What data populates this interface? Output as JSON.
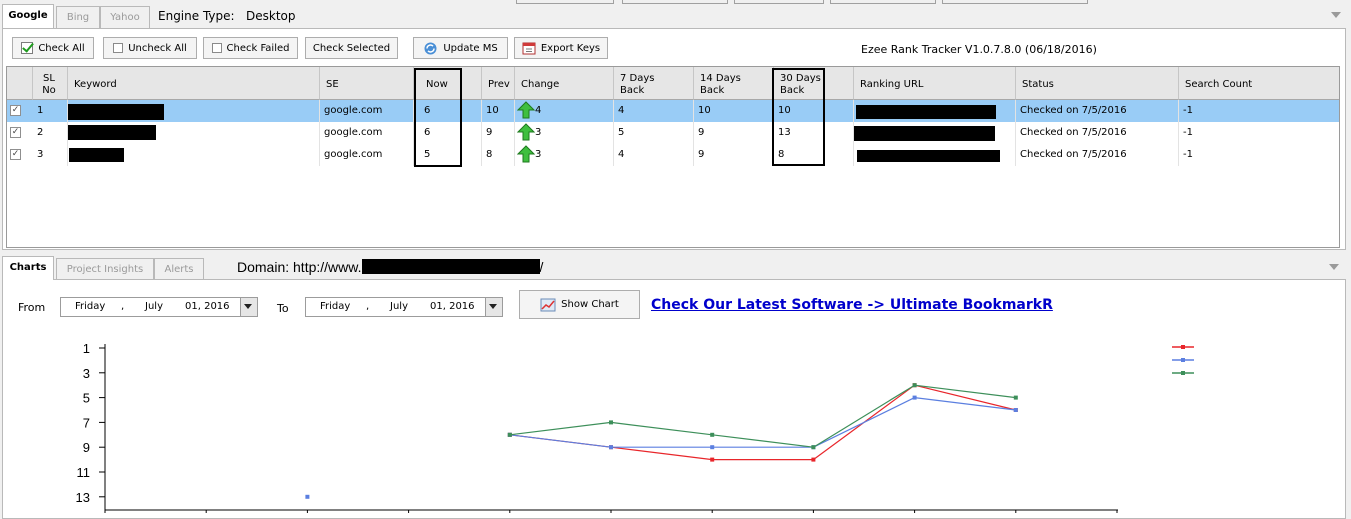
{
  "top_tabs": [
    {
      "label": "Google",
      "active": true
    },
    {
      "label": "Bing",
      "active": false
    },
    {
      "label": "Yahoo",
      "active": false
    }
  ],
  "engine_type_label": "Engine Type:",
  "engine_type_value": "Desktop",
  "toolbar": {
    "check_all": "Check All",
    "uncheck_all": "Uncheck All",
    "check_failed": "Check Failed",
    "check_selected": "Check Selected",
    "update_ms": "Update MS",
    "export_keys": "Export Keys"
  },
  "app_title": "Ezee Rank Tracker V1.0.7.8.0 (06/18/2016)",
  "grid": {
    "headers": [
      "SL No",
      "Keyword",
      "SE",
      "Now",
      "Prev",
      "Change",
      "7 Days Back",
      "14 Days Back",
      "30 Days Back",
      "Ranking URL",
      "Status",
      "Search Count"
    ],
    "rows": [
      {
        "sl": "1",
        "se": "google.com",
        "now": "6",
        "prev": "10",
        "change": "4",
        "d7": "4",
        "d14": "10",
        "d30": "10",
        "status": "Checked on 7/5/2016",
        "count": "-1"
      },
      {
        "sl": "2",
        "se": "google.com",
        "now": "6",
        "prev": "9",
        "change": "3",
        "d7": "5",
        "d14": "9",
        "d30": "13",
        "status": "Checked on 7/5/2016",
        "count": "-1"
      },
      {
        "sl": "3",
        "se": "google.com",
        "now": "5",
        "prev": "8",
        "change": "3",
        "d7": "4",
        "d14": "9",
        "d30": "8",
        "status": "Checked on 7/5/2016",
        "count": "-1"
      }
    ]
  },
  "bottom_tabs": [
    {
      "label": "Charts",
      "active": true
    },
    {
      "label": "Project Insights",
      "active": false
    },
    {
      "label": "Alerts",
      "active": false
    }
  ],
  "domain_label": "Domain: http://www.",
  "domain_suffix": "/",
  "chart_controls": {
    "from_label": "From",
    "to_label": "To",
    "from_date": {
      "day": "Friday",
      "sep": ",",
      "month": "July",
      "date": "01, 2016"
    },
    "to_date": {
      "day": "Friday",
      "sep": ",",
      "month": "July",
      "date": "01, 2016"
    },
    "show_chart": "Show Chart",
    "promo_link": "Check Our Latest Software -> Ultimate BookmarkR"
  },
  "colors": {
    "red": "#e8262b",
    "blue": "#5b7fe0",
    "green": "#3d8f5a",
    "selection": "#99ccf6",
    "link": "#0000cc"
  },
  "chart_data": {
    "type": "line",
    "y_ticks": [
      "1",
      "3",
      "5",
      "7",
      "9",
      "11",
      "13"
    ],
    "ylim": [
      1,
      14
    ],
    "y_inverted": true,
    "x": [
      0,
      1,
      2,
      3,
      4,
      5,
      6,
      7,
      8,
      9
    ],
    "series": [
      {
        "color": "#e8262b",
        "values": [
          null,
          null,
          null,
          null,
          8,
          9,
          10,
          10,
          4,
          6
        ]
      },
      {
        "color": "#5b7fe0",
        "values": [
          null,
          null,
          13,
          null,
          8,
          9,
          9,
          9,
          5,
          6
        ]
      },
      {
        "color": "#3d8f5a",
        "values": [
          null,
          null,
          null,
          null,
          8,
          7,
          8,
          9,
          4,
          5
        ]
      }
    ],
    "legend_position": "top-right",
    "grid": false
  }
}
